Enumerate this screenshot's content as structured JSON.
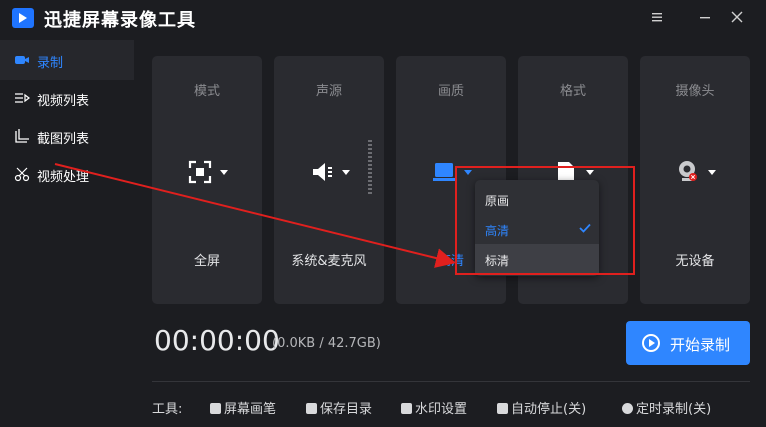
{
  "window": {
    "title": "迅捷屏幕录像工具",
    "menu_icon": "menu-icon",
    "minimize_icon": "minimize-icon",
    "close_icon": "close-icon"
  },
  "sidebar": {
    "items": [
      {
        "label": "录制",
        "icon": "video-camera-icon",
        "active": true
      },
      {
        "label": "视频列表",
        "icon": "video-list-icon"
      },
      {
        "label": "截图列表",
        "icon": "screenshot-list-icon"
      },
      {
        "label": "视频处理",
        "icon": "video-edit-icon"
      }
    ]
  },
  "cards": [
    {
      "title": "模式",
      "value": "全屏",
      "icon": "fullscreen-icon"
    },
    {
      "title": "声源",
      "value": "系统&麦克风",
      "icon": "speaker-icon"
    },
    {
      "title": "画质",
      "value": "高清",
      "icon": "monitor-icon"
    },
    {
      "title": "格式",
      "value": "",
      "icon": "file-icon"
    },
    {
      "title": "摄像头",
      "value": "无设备",
      "icon": "webcam-icon"
    }
  ],
  "quality_dropdown": {
    "options": [
      "原画",
      "高清",
      "标清"
    ],
    "selected": "高清",
    "hovered": "标清"
  },
  "recording": {
    "timer": "00:00:00",
    "storage": "(0.0KB / 42.7GB)",
    "start_label": "开始录制"
  },
  "toolbar": {
    "label": "工具:",
    "items": [
      "屏幕画笔",
      "保存目录",
      "水印设置",
      "自动停止(关)",
      "定时录制(关)"
    ]
  },
  "colors": {
    "accent": "#2f86ff",
    "annotation": "#e0201e",
    "background": "#1c1d21",
    "card": "#2a2b30"
  }
}
